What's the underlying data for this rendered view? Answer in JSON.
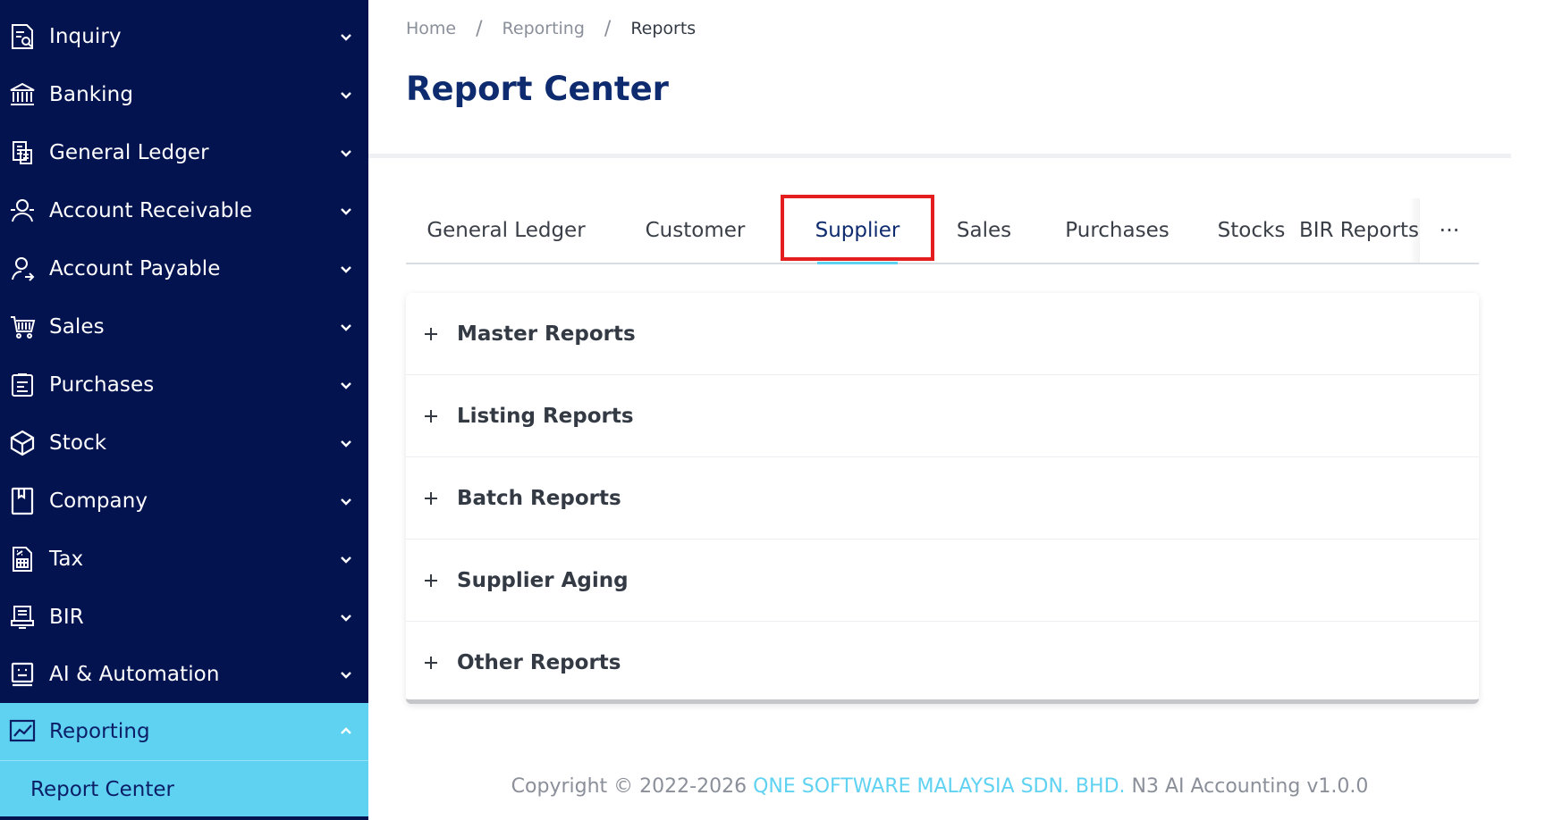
{
  "sidebar": {
    "items": [
      {
        "label": "Inquiry",
        "icon": "inquiry-icon"
      },
      {
        "label": "Banking",
        "icon": "bank-icon"
      },
      {
        "label": "General Ledger",
        "icon": "ledger-icon"
      },
      {
        "label": "Account Receivable",
        "icon": "receivable-icon"
      },
      {
        "label": "Account Payable",
        "icon": "payable-icon"
      },
      {
        "label": "Sales",
        "icon": "cart-icon"
      },
      {
        "label": "Purchases",
        "icon": "clipboard-icon"
      },
      {
        "label": "Stock",
        "icon": "cube-icon"
      },
      {
        "label": "Company",
        "icon": "bookmark-icon"
      },
      {
        "label": "Tax",
        "icon": "tax-icon"
      },
      {
        "label": "BIR",
        "icon": "monitor-icon"
      },
      {
        "label": "AI & Automation",
        "icon": "robot-icon"
      },
      {
        "label": "Reporting",
        "icon": "chart-line-icon",
        "expanded": true
      }
    ],
    "sub_items": [
      {
        "label": "Report Center",
        "active": true
      }
    ]
  },
  "breadcrumb": {
    "home": "Home",
    "reporting": "Reporting",
    "current": "Reports"
  },
  "page": {
    "title": "Report Center"
  },
  "tabs": {
    "items": [
      "General Ledger",
      "Customer",
      "Supplier",
      "Sales",
      "Purchases",
      "Stocks",
      "BIR Reports"
    ],
    "active": "Supplier",
    "more_label": "···"
  },
  "accordion": {
    "sections": [
      "Master Reports",
      "Listing Reports",
      "Batch Reports",
      "Supplier Aging",
      "Other Reports"
    ]
  },
  "footer": {
    "prefix": "Copyright © 2022-2026 ",
    "company": "QNE SOFTWARE MALAYSIA SDN. BHD.",
    "suffix": " N3 AI Accounting v1.0.0"
  },
  "colors": {
    "sidebar_bg": "#03134f",
    "accent": "#5fd2f2",
    "title": "#0d2b6e",
    "highlight": "#e41e1e"
  }
}
